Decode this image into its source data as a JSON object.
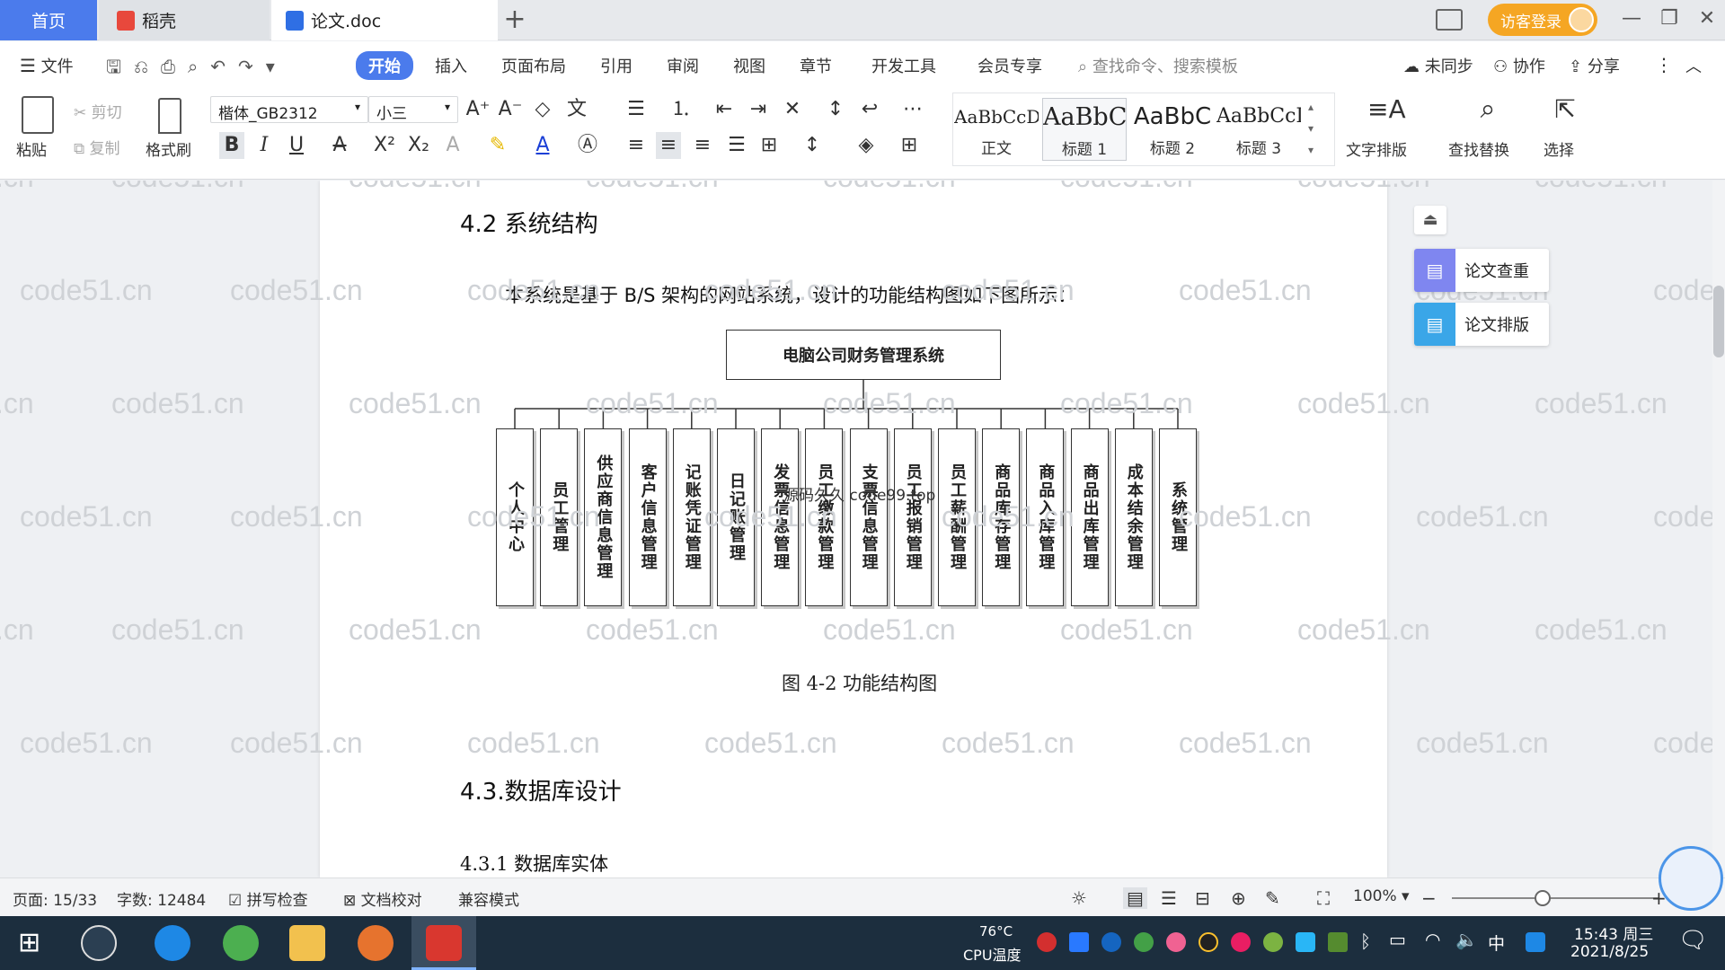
{
  "tabs": {
    "home": "首页",
    "daoke": "稻壳",
    "doc": "论文.doc"
  },
  "titlebar": {
    "login": "访客登录"
  },
  "menu": [
    "文件",
    "开始",
    "插入",
    "页面布局",
    "引用",
    "审阅",
    "视图",
    "章节",
    "开发工具",
    "会员专享"
  ],
  "search": {
    "placeholder": "查找命令、搜索模板"
  },
  "right_menu": {
    "sync": "未同步",
    "collab": "协作",
    "share": "分享"
  },
  "ribbon": {
    "paste": "粘贴",
    "cut": "剪切",
    "copy": "复制",
    "format_painter": "格式刷",
    "font": "楷体_GB2312",
    "size": "小三",
    "styles": [
      {
        "sample": "AaBbCcDd",
        "label": "正文"
      },
      {
        "sample": "AaBbC",
        "label": "标题 1"
      },
      {
        "sample": "AaBbC",
        "label": "标题 2"
      },
      {
        "sample": "AaBbCcI",
        "label": "标题 3"
      }
    ],
    "text_layout": "文字排版",
    "find_replace": "查找替换",
    "select": "选择"
  },
  "document": {
    "section_42": "4.2 系统结构",
    "para": "本系统是基于 B/S 架构的网站系统，设计的功能结构图如下图所示：",
    "diagram": {
      "root": "电脑公司财务管理系统",
      "children": [
        "个人中心",
        "员工管理",
        "供应商信息管理",
        "客户信息管理",
        "记账凭证管理",
        "日记账管理",
        "发票信息管理",
        "员工缴款管理",
        "支票信息管理",
        "员工报销管理",
        "员工薪酬管理",
        "商品库存管理",
        "商品入库管理",
        "商品出库管理",
        "成本结余管理",
        "系统管理"
      ],
      "overlay_text": "源码久久 code99.top"
    },
    "caption": "图 4-2 功能结构图",
    "section_43": "4.3.数据库设计",
    "section_431": "4.3.1 数据库实体",
    "watermark": "code51.cn"
  },
  "side_panel": {
    "check": "论文查重",
    "layout": "论文排版"
  },
  "status": {
    "page": "页面: 15/33",
    "words": "字数: 12484",
    "spell": "拼写检查",
    "proof": "文档校对",
    "compat": "兼容模式",
    "zoom": "100%"
  },
  "taskbar": {
    "temp": "76°C",
    "cpu": "CPU温度",
    "ime": "中",
    "time": "15:43 周三",
    "date": "2021/8/25"
  },
  "colors": {
    "accent": "#4b7bec",
    "login": "#f5a623",
    "taskbar": "#1c2e3e"
  }
}
